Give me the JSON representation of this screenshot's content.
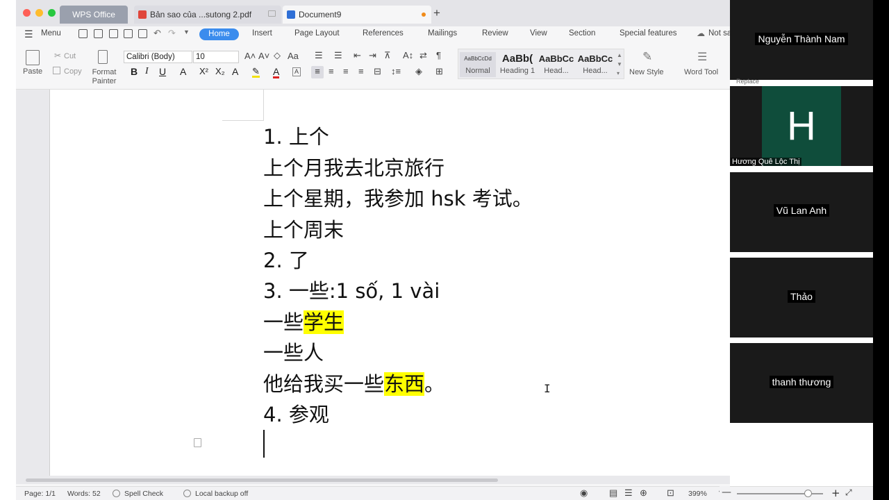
{
  "window": {
    "tabs": [
      {
        "label": "WPS Office"
      },
      {
        "label": "Bản sao của ...sutong 2.pdf"
      },
      {
        "label": "Document9"
      }
    ]
  },
  "menu": {
    "menu_label": "Menu",
    "items": [
      "Home",
      "Insert",
      "Page Layout",
      "References",
      "Mailings",
      "Review",
      "View",
      "Section",
      "Special features",
      "Not sa"
    ]
  },
  "ribbon": {
    "paste": "Paste",
    "cut": "Cut",
    "copy": "Copy",
    "format_painter": "Format Painter",
    "font_name": "Calibri (Body)",
    "font_size": "10",
    "styles": [
      {
        "sample": "AaBbCcDd",
        "name": "Normal"
      },
      {
        "sample": "AaBb(",
        "name": "Heading 1"
      },
      {
        "sample": "AaBbCc",
        "name": "Head..."
      },
      {
        "sample": "AaBbCc",
        "name": "Head..."
      }
    ],
    "new_style": "New Style",
    "word_tool": "Word Tool",
    "replace": "Replace"
  },
  "document": {
    "lines": [
      "1. 上个",
      "上个月我去北京旅行",
      "上个星期，我参加 hsk 考试。",
      "上个周末",
      "2. 了",
      "3. 一些:1 số, 1 vài"
    ],
    "line7_pre": "一些",
    "line7_hl": "学生",
    "line8": "一些人",
    "line9_pre": "他给我买一些",
    "line9_hl": "东西",
    "line9_post": "。",
    "line10": "4. 参观",
    "highlight_color": "#ffff00"
  },
  "status": {
    "page": "Page: 1/1",
    "words": "Words: 52",
    "spell_check": "Spell Check",
    "backup": "Local backup off",
    "zoom": "399%",
    "zoom_level_fraction": 0.82
  },
  "participants": [
    {
      "name": "Nguyễn Thành Nam"
    },
    {
      "name": "Hương Quê Lộc Thị",
      "avatar_letter": "H"
    },
    {
      "name": "Vũ Lan Anh"
    },
    {
      "name": "Thảo"
    },
    {
      "name": "thanh thương"
    }
  ],
  "colors": {
    "accent": "#3b8ced",
    "avatar_bg": "#0f4d3b"
  }
}
